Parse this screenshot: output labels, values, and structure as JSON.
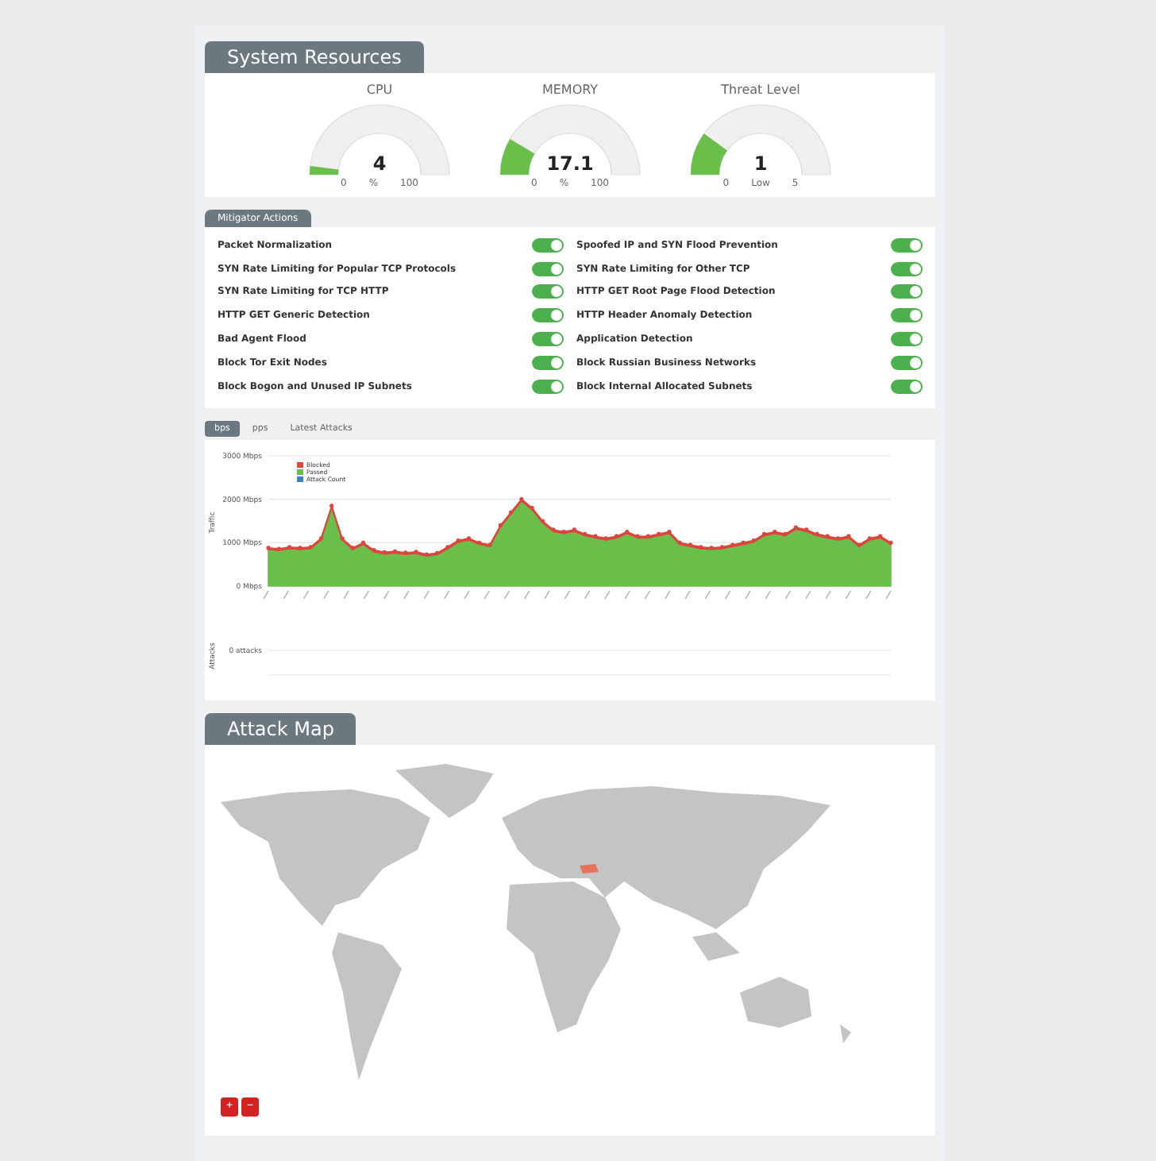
{
  "system_resources": {
    "title": "System Resources",
    "gauges": [
      {
        "label": "CPU",
        "value": "4",
        "unit": "%",
        "min": "0",
        "max": "100",
        "level": 0.04
      },
      {
        "label": "MEMORY",
        "value": "17.1",
        "unit": "%",
        "min": "0",
        "max": "100",
        "level": 0.171
      },
      {
        "label": "Threat Level",
        "value": "1",
        "unit": "Low",
        "min": "0",
        "max": "5",
        "level": 0.2
      }
    ]
  },
  "mitigator_actions": {
    "title": "Mitigator Actions",
    "items": [
      {
        "label": "Packet Normalization",
        "on": true
      },
      {
        "label": "Spoofed IP and SYN Flood Prevention",
        "on": true
      },
      {
        "label": "SYN Rate Limiting for Popular TCP Protocols",
        "on": true
      },
      {
        "label": "SYN Rate Limiting for Other TCP",
        "on": true
      },
      {
        "label": "SYN Rate Limiting for TCP HTTP",
        "on": true
      },
      {
        "label": "HTTP GET Root Page Flood Detection",
        "on": true
      },
      {
        "label": "HTTP GET Generic Detection",
        "on": true
      },
      {
        "label": "HTTP Header Anomaly Detection",
        "on": true
      },
      {
        "label": "Bad Agent Flood",
        "on": true
      },
      {
        "label": "Application Detection",
        "on": true
      },
      {
        "label": "Block Tor Exit Nodes",
        "on": true
      },
      {
        "label": "Block Russian Business Networks",
        "on": true
      },
      {
        "label": "Block Bogon and Unused IP Subnets",
        "on": true
      },
      {
        "label": "Block Internal Allocated Subnets",
        "on": true
      }
    ]
  },
  "traffic": {
    "tabs": [
      {
        "label": "bps",
        "selected": true
      },
      {
        "label": "pps",
        "selected": false
      },
      {
        "label": "Latest Attacks",
        "selected": false
      }
    ],
    "chart_data": {
      "type": "area",
      "stacked": true,
      "legend": "top-left",
      "ylabel": "Traffic",
      "ylim": [
        0,
        3000
      ],
      "yticks": [
        {
          "value": 0,
          "label": "0 Mbps"
        },
        {
          "value": 1000,
          "label": "1000 Mbps"
        },
        {
          "value": 2000,
          "label": "2000 Mbps"
        },
        {
          "value": 3000,
          "label": "3000 Mbps"
        }
      ],
      "series": [
        {
          "name": "Blocked",
          "color": "#e0443c",
          "values": [
            40,
            40,
            40,
            40,
            40,
            40,
            40,
            40,
            40,
            40,
            40,
            40,
            40,
            40,
            40,
            40,
            40,
            40,
            40,
            40,
            40,
            40,
            40,
            40,
            40,
            40,
            40,
            40,
            40,
            40,
            40,
            40,
            40,
            40,
            40,
            40,
            40,
            40,
            40,
            40,
            40,
            40,
            40,
            40,
            40,
            40,
            40,
            40,
            40,
            40,
            40,
            40,
            40,
            40,
            40,
            40,
            40,
            40,
            40,
            40
          ]
        },
        {
          "name": "Passed",
          "color": "#6abf4b",
          "values": [
            840,
            820,
            860,
            840,
            860,
            1060,
            1810,
            1060,
            840,
            960,
            790,
            740,
            760,
            730,
            750,
            690,
            720,
            860,
            1010,
            1060,
            960,
            910,
            1360,
            1660,
            1960,
            1760,
            1460,
            1260,
            1210,
            1260,
            1160,
            1110,
            1060,
            1110,
            1210,
            1110,
            1110,
            1160,
            1210,
            960,
            910,
            860,
            840,
            860,
            910,
            960,
            1010,
            1160,
            1210,
            1160,
            1310,
            1260,
            1160,
            1110,
            1060,
            1110,
            910,
            1060,
            1110,
            960
          ]
        },
        {
          "name": "Attack Count",
          "color": "#3b82c4"
        }
      ]
    },
    "attacks_axis": {
      "ylabel": "Attacks",
      "tick": "0 attacks"
    }
  },
  "attack_map": {
    "title": "Attack Map",
    "zoom_buttons": [
      "+",
      "−"
    ]
  }
}
